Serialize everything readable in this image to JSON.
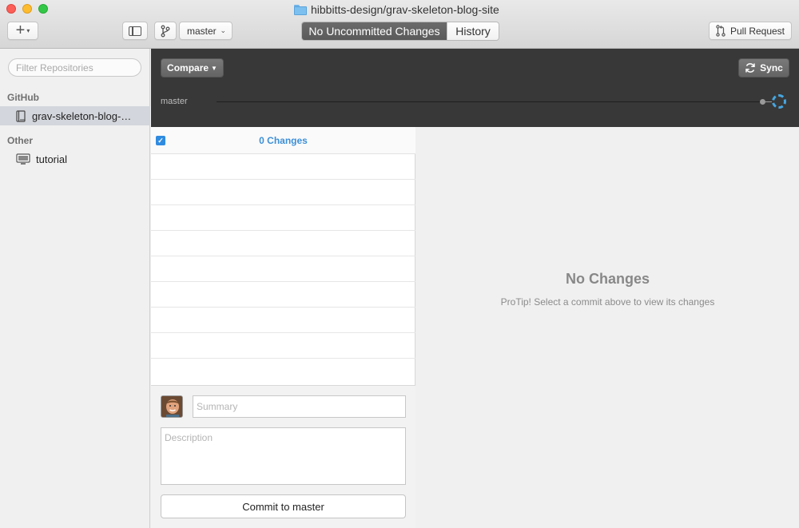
{
  "window": {
    "title": "hibbitts-design/grav-skeleton-blog-site",
    "title_icon": "folder-icon"
  },
  "toolbar": {
    "add_icon": "plus-icon",
    "sidebar_toggle_icon": "sidebar-icon",
    "branch_icon": "branch-icon",
    "branch_select": "master",
    "tabs": [
      {
        "label": "No Uncommitted Changes",
        "active": true
      },
      {
        "label": "History",
        "active": false
      }
    ],
    "pull_request_label": "Pull Request"
  },
  "sidebar": {
    "filter_placeholder": "Filter Repositories",
    "sections": [
      {
        "label": "GitHub",
        "items": [
          {
            "label": "grav-skeleton-blog-…",
            "icon": "repo-book-icon",
            "selected": true
          }
        ]
      },
      {
        "label": "Other",
        "items": [
          {
            "label": "tutorial",
            "icon": "monitor-icon",
            "selected": false
          }
        ]
      }
    ]
  },
  "compare_bar": {
    "compare_label": "Compare",
    "sync_label": "Sync",
    "branch_label": "master"
  },
  "changes": {
    "count_label": "0 Changes",
    "all_checked": true
  },
  "commit": {
    "summary_placeholder": "Summary",
    "description_placeholder": "Description",
    "button_label": "Commit to master"
  },
  "diff": {
    "title": "No Changes",
    "protip": "ProTip! Select a commit above to view its changes"
  },
  "colors": {
    "accent_blue": "#3d8fd6",
    "compare_bar_bg": "#383838",
    "active_tab_bg": "#5f5f5f"
  }
}
